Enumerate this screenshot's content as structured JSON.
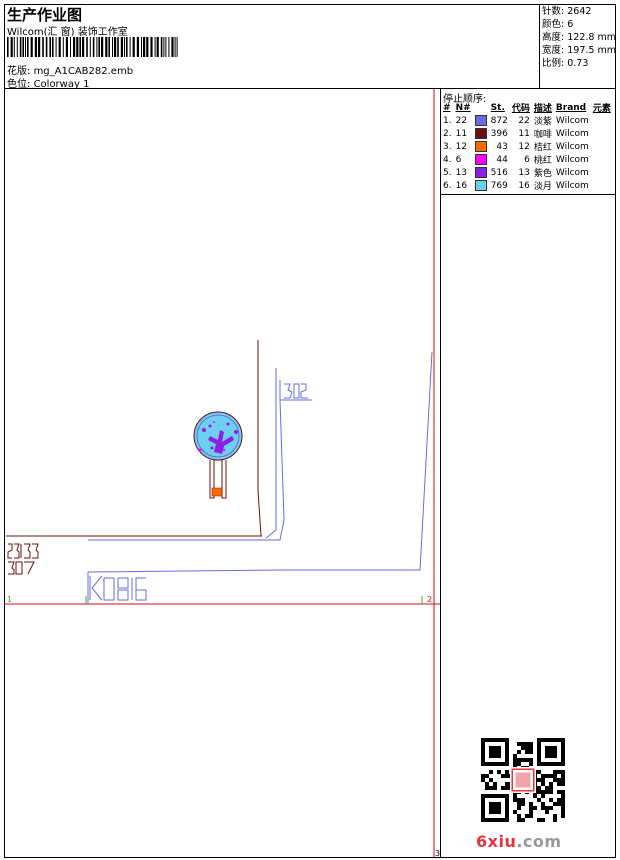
{
  "header": {
    "title": "生产作业图",
    "company": "Wilcom(汇 窗) 装饰工作室",
    "file_label": "花版:",
    "file_name": "mg_A1CAB282.emb",
    "colorway_label": "色位:",
    "colorway_name": "Colorway 1"
  },
  "info": [
    {
      "label": "针数:",
      "value": "2642"
    },
    {
      "label": "颜色:",
      "value": "6"
    },
    {
      "label": "高度:",
      "value": "122.8 mm"
    },
    {
      "label": "宽度:",
      "value": "197.5 mm"
    },
    {
      "label": "比例:",
      "value": "0.73"
    }
  ],
  "sequence": {
    "title": "停止顺序:",
    "columns": [
      "#",
      "N#",
      "St.",
      "代码",
      "描述",
      "Brand",
      "元素"
    ],
    "rows": [
      {
        "idx": "1.",
        "n": "22",
        "color": "#6b6bdc",
        "st": "872",
        "code": "22",
        "desc": "淡紫",
        "brand": "Wilcom"
      },
      {
        "idx": "2.",
        "n": "11",
        "color": "#6b0f0f",
        "st": "396",
        "code": "11",
        "desc": "咖啡",
        "brand": "Wilcom"
      },
      {
        "idx": "3.",
        "n": "12",
        "color": "#ff6a00",
        "st": "43",
        "code": "12",
        "desc": "桔红",
        "brand": "Wilcom"
      },
      {
        "idx": "4.",
        "n": "6",
        "color": "#ff00ff",
        "st": "44",
        "code": "6",
        "desc": "桃红",
        "brand": "Wilcom"
      },
      {
        "idx": "5.",
        "n": "13",
        "color": "#8b1fe6",
        "st": "516",
        "code": "13",
        "desc": "紫色",
        "brand": "Wilcom"
      },
      {
        "idx": "6.",
        "n": "16",
        "color": "#6fcff0",
        "st": "769",
        "code": "16",
        "desc": "淡月",
        "brand": "Wilcom"
      }
    ]
  },
  "design": {
    "marker_left": "1",
    "marker_right": "2",
    "corner_mark": "3"
  },
  "watermark": {
    "site_main": "6xiu",
    "site_tld": ".com"
  }
}
